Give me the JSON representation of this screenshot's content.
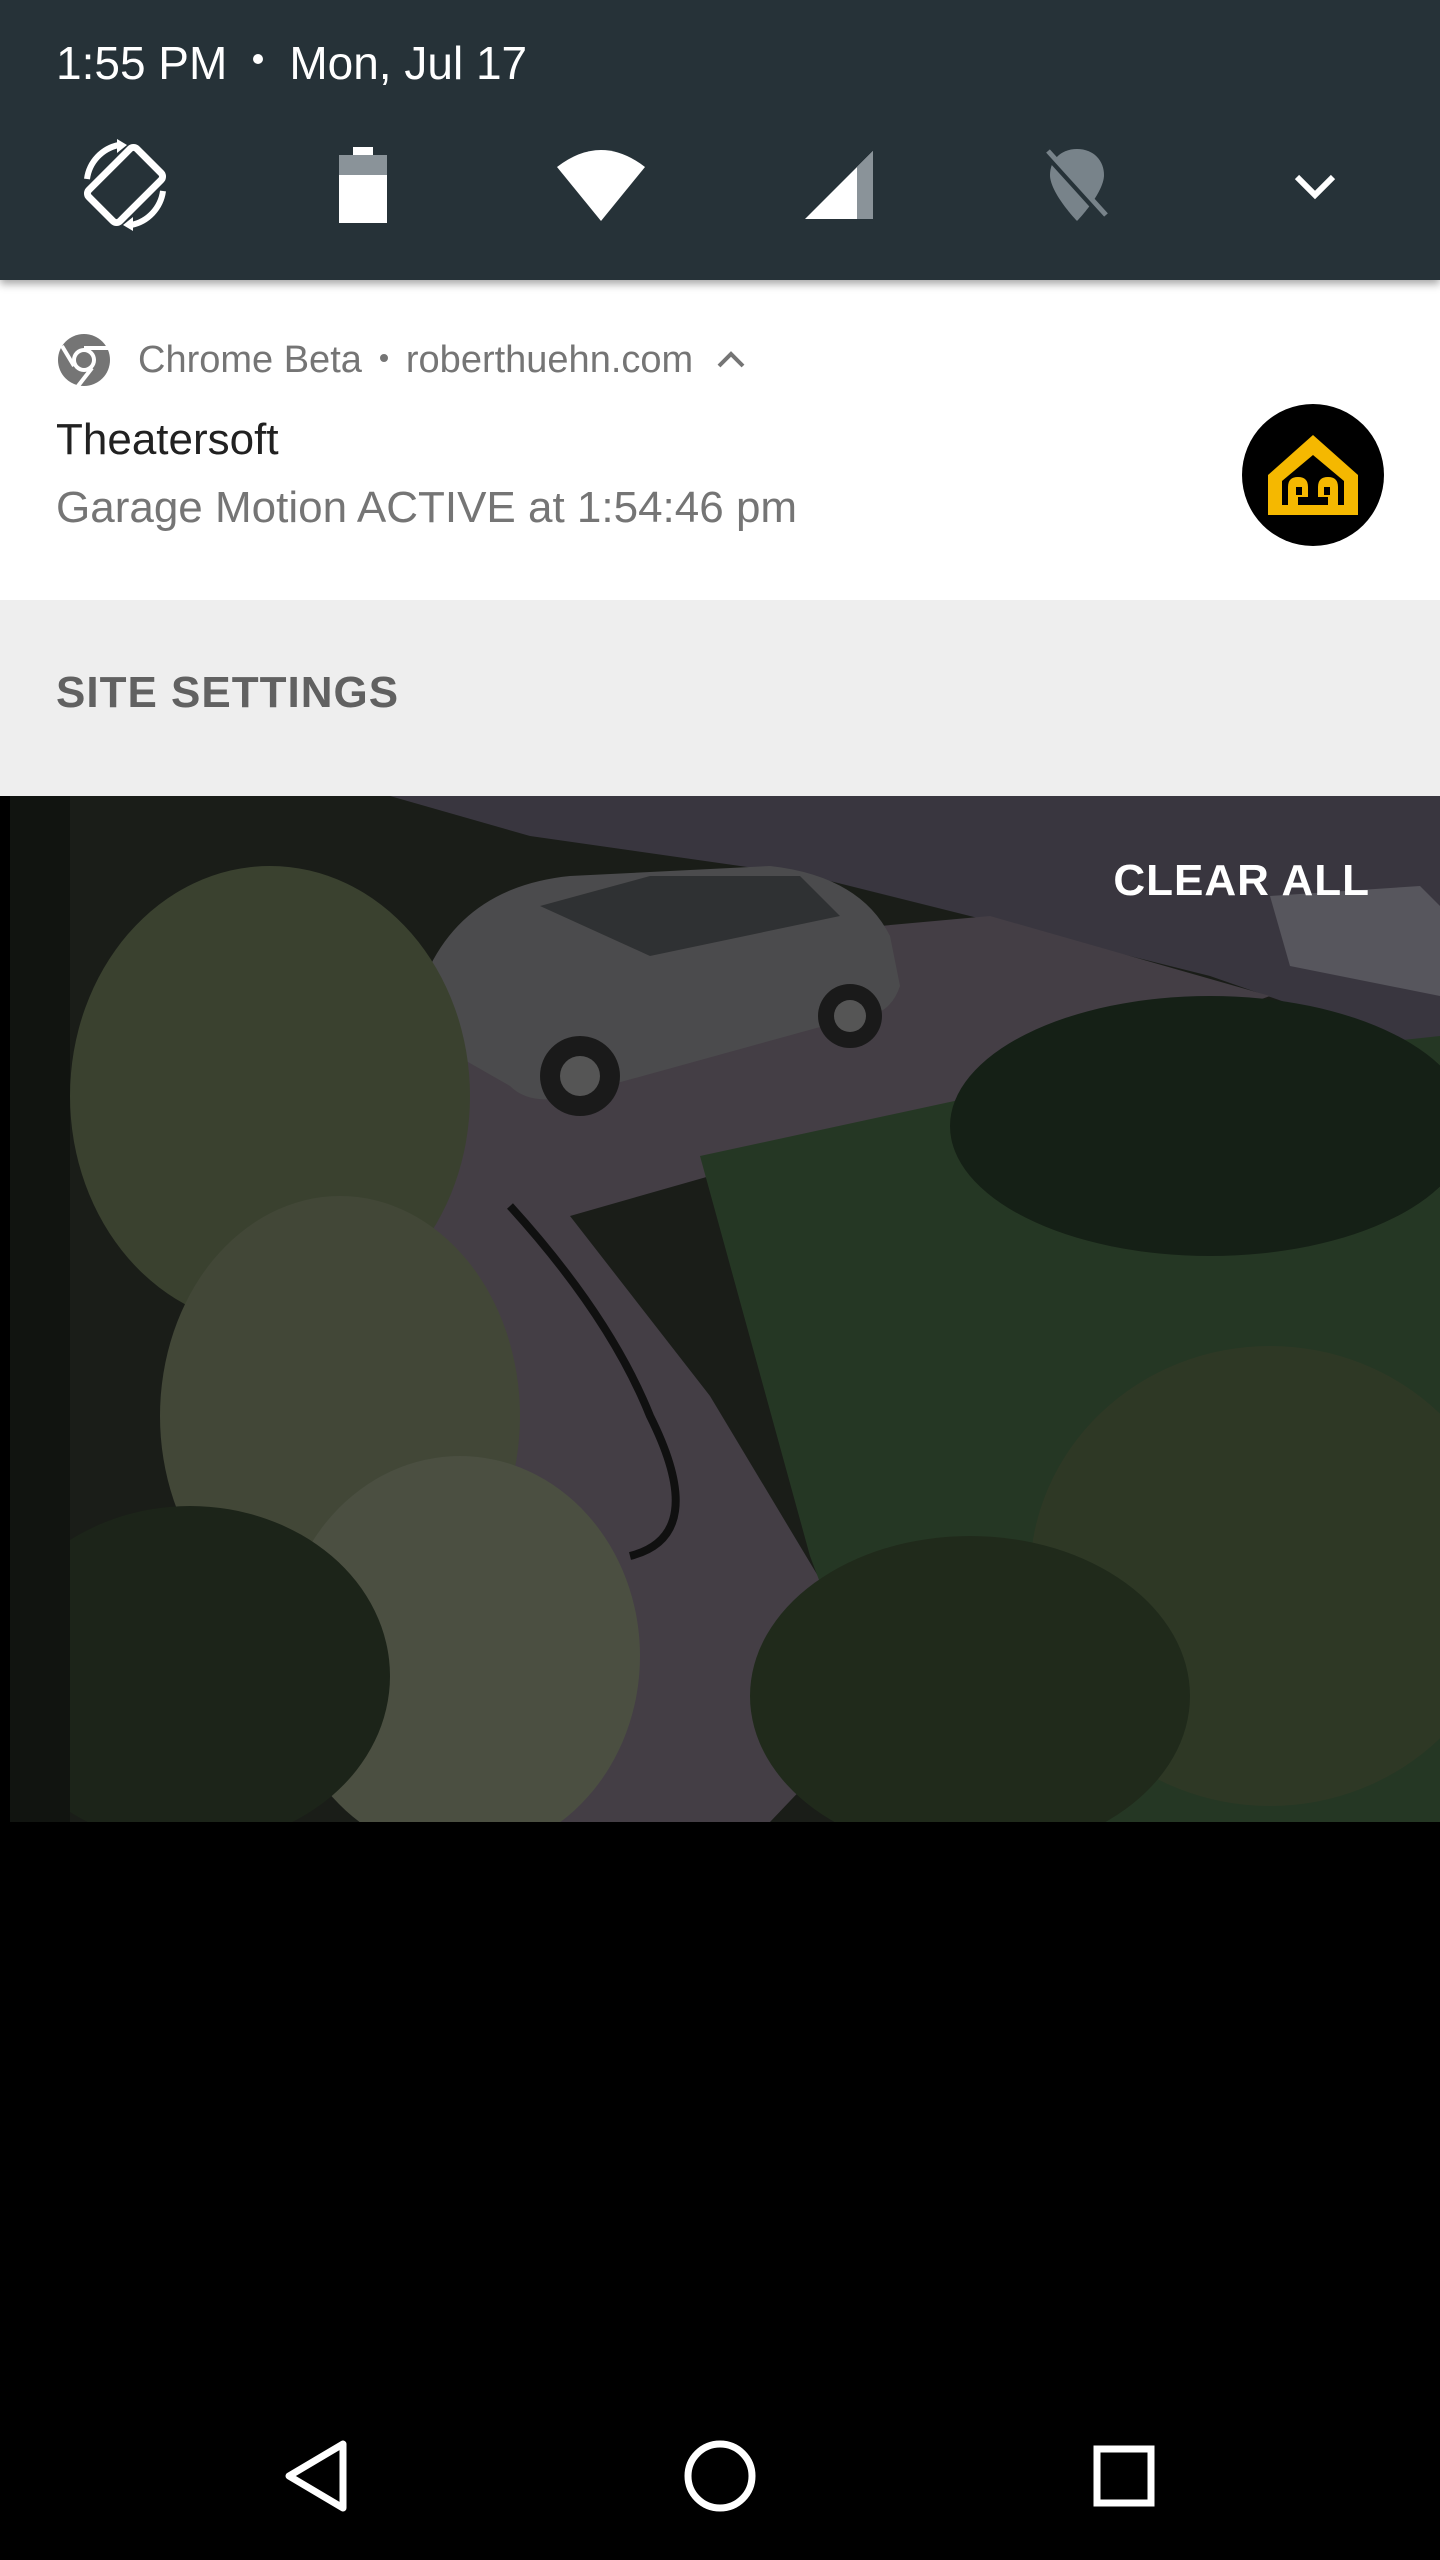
{
  "status": {
    "time": "1:55 PM",
    "date": "Mon, Jul 17"
  },
  "quick_settings": {
    "tiles": [
      {
        "icon": "auto-rotate-icon"
      },
      {
        "icon": "battery-icon"
      },
      {
        "icon": "wifi-icon"
      },
      {
        "icon": "cell-signal-icon"
      },
      {
        "icon": "location-off-icon"
      },
      {
        "icon": "chevron-down-icon"
      }
    ]
  },
  "notification": {
    "app_name": "Chrome Beta",
    "source": "roberthuehn.com",
    "title": "Theatersoft",
    "text": "Garage Motion ACTIVE at 1:54:46 pm",
    "large_icon": "theatersoft-logo",
    "accent_color": "#f5b800"
  },
  "actions": {
    "site_settings": "SITE SETTINGS"
  },
  "shade": {
    "clear_all": "CLEAR ALL"
  },
  "navbar": {
    "back": "back-icon",
    "home": "home-icon",
    "recents": "recents-icon"
  }
}
